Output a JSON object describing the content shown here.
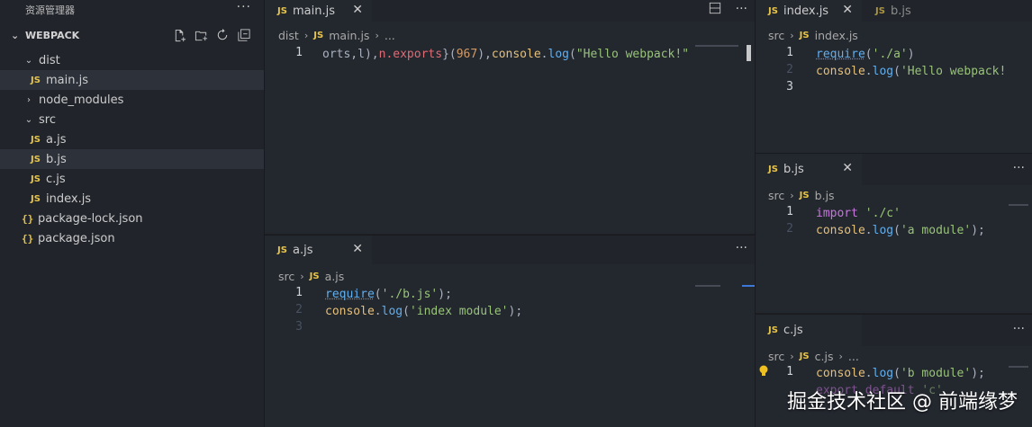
{
  "explorer": {
    "title": "资源管理器",
    "more": "···",
    "root": "WEBPACK",
    "items": [
      {
        "label": "dist",
        "type": "folder",
        "open": true
      },
      {
        "label": "main.js",
        "type": "js"
      },
      {
        "label": "node_modules",
        "type": "folder",
        "open": false
      },
      {
        "label": "src",
        "type": "folder",
        "open": true
      },
      {
        "label": "a.js",
        "type": "js"
      },
      {
        "label": "b.js",
        "type": "js"
      },
      {
        "label": "c.js",
        "type": "js"
      },
      {
        "label": "index.js",
        "type": "js"
      },
      {
        "label": "package-lock.json",
        "type": "json"
      },
      {
        "label": "package.json",
        "type": "json"
      }
    ]
  },
  "badges": {
    "js": "JS",
    "json": "{}"
  },
  "panes": {
    "main": {
      "tab": "main.js",
      "crumbs": [
        "dist",
        "main.js",
        "..."
      ],
      "line_numbers": [
        "1"
      ],
      "code": {
        "p1": "orts,l),",
        "p2": "n.exports",
        "p3": "}(",
        "p4": "967",
        "p5": "),",
        "p6": "console",
        "p7": ".",
        "p8": "log",
        "p9": "(",
        "p10": "\"Hello webpack!\""
      }
    },
    "a": {
      "tab": "a.js",
      "crumbs": [
        "src",
        "a.js"
      ],
      "line_numbers": [
        "1",
        "2",
        "3"
      ],
      "l1": {
        "fn": "require",
        "open": "(",
        "str": "'./b.js'",
        "close": ");"
      },
      "l2": {
        "obj": "console",
        "dot": ".",
        "fn": "log",
        "open": "(",
        "str": "'index module'",
        "close": ");"
      }
    },
    "index": {
      "tab": "index.js",
      "tab2": "b.js",
      "crumbs": [
        "src",
        "index.js"
      ],
      "line_numbers": [
        "1",
        "2",
        "3"
      ],
      "l1": {
        "fn": "require",
        "open": "(",
        "str": "'./a'",
        "close": ")"
      },
      "l2": {
        "obj": "console",
        "dot": ".",
        "fn": "log",
        "open": "(",
        "str": "'Hello webpack!"
      }
    },
    "b": {
      "tab": "b.js",
      "crumbs": [
        "src",
        "b.js"
      ],
      "line_numbers": [
        "1",
        "2"
      ],
      "l1": {
        "kw": "import",
        "str": "'./c'"
      },
      "l2": {
        "obj": "console",
        "dot": ".",
        "fn": "log",
        "open": "(",
        "str": "'a module'",
        "close": ");"
      }
    },
    "c": {
      "tab": "c.js",
      "crumbs": [
        "src",
        "c.js",
        "..."
      ],
      "line_numbers": [
        "1"
      ],
      "l1": {
        "obj": "console",
        "dot": ".",
        "fn": "log",
        "open": "(",
        "str": "'b module'",
        "close": ");"
      },
      "l2": {
        "kw": "export default",
        "str": "'c'"
      }
    }
  },
  "icons": {
    "close": "✕",
    "more": "···",
    "split": "◫"
  },
  "watermark": "掘金技术社区 @ 前端缘梦",
  "colors": {
    "bg": "#23272e",
    "sidebar": "#21252b",
    "js_badge": "#e8c547",
    "string": "#98c379",
    "function": "#61afef",
    "keyword": "#c678dd"
  }
}
